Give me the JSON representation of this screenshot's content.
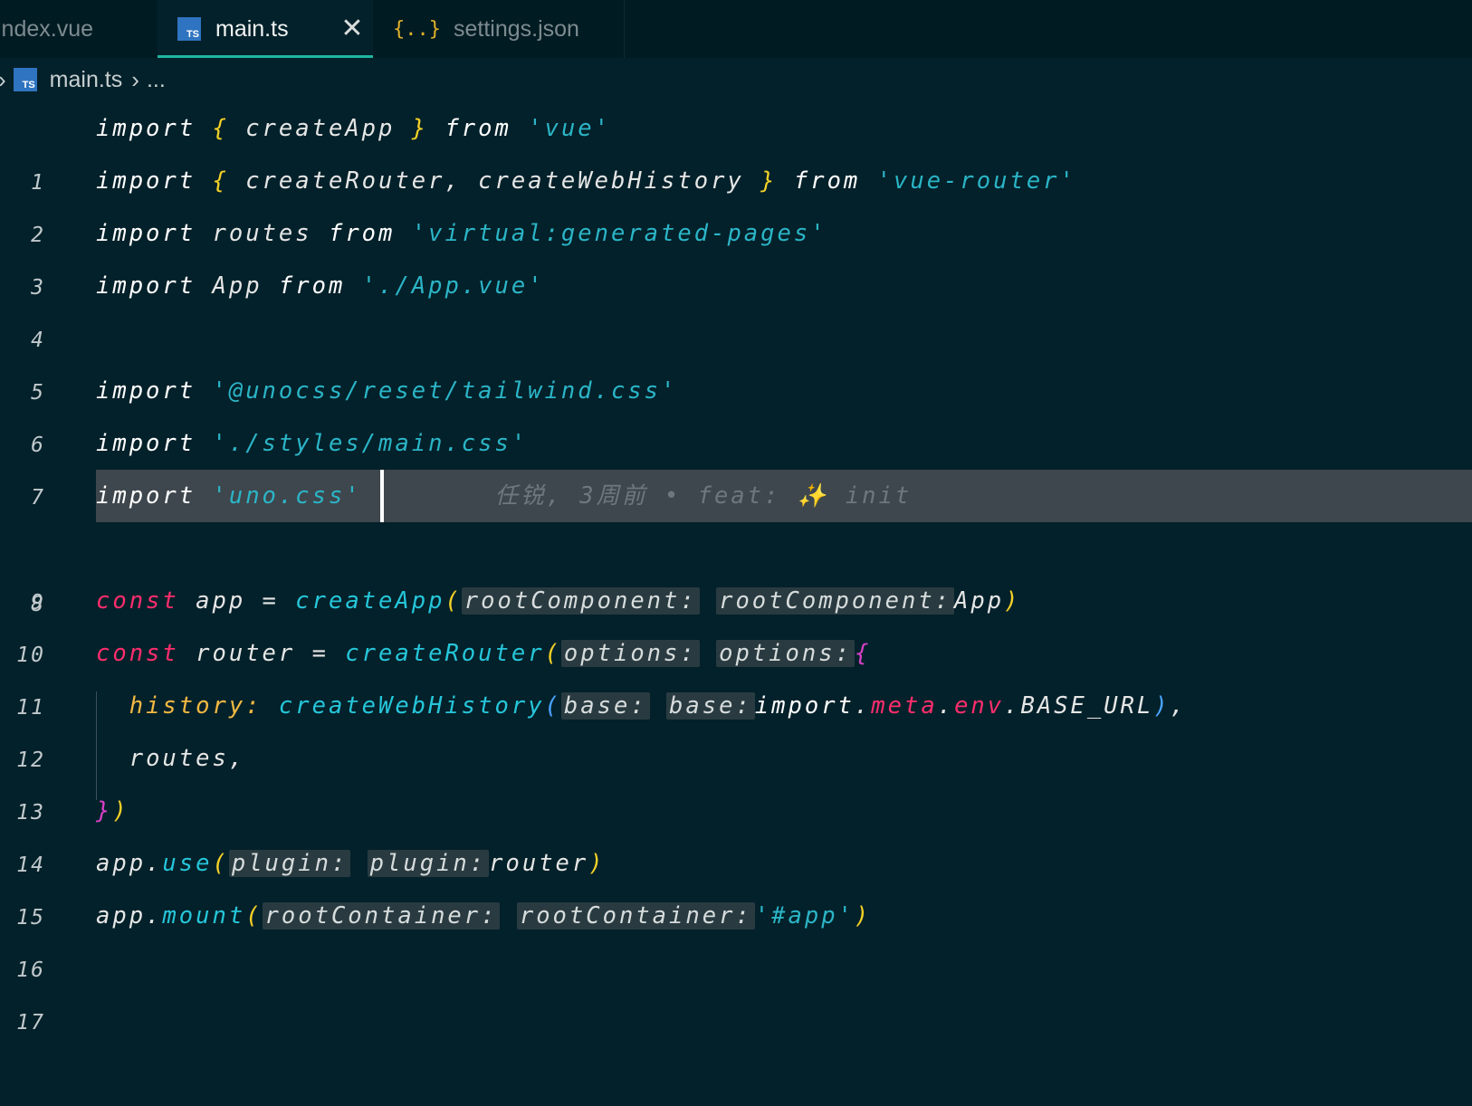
{
  "tabs": [
    {
      "label": "index.vue"
    },
    {
      "label": "main.ts",
      "icon": "ts-icon"
    },
    {
      "label": "settings.json",
      "icon": "json-icon"
    }
  ],
  "tab_close": "✕",
  "breadcrumb": {
    "file": "main.ts",
    "rest": "..."
  },
  "line_numbers": [
    "1",
    "2",
    "3",
    "4",
    "5",
    "6",
    "7",
    "8",
    "9",
    "10",
    "11",
    "12",
    "13",
    "14",
    "15",
    "16",
    "17"
  ],
  "code": {
    "l1": {
      "import": "import",
      "lb": "{",
      "name": "createApp",
      "rb": "}",
      "from": "from",
      "str": "'vue'"
    },
    "l2": {
      "import": "import",
      "lb": "{",
      "name": "createRouter,",
      "name2": "createWebHistory",
      "rb": "}",
      "from": "from",
      "str": "'vue-router'"
    },
    "l3": {
      "import": "import",
      "name": "routes",
      "from": "from",
      "str": "'virtual:generated-pages'"
    },
    "l4": {
      "import": "import",
      "name": "App",
      "from": "from",
      "str": "'./App.vue'"
    },
    "l6": {
      "import": "import",
      "str": "'@unocss/reset/tailwind.css'"
    },
    "l7": {
      "import": "import",
      "str": "'./styles/main.css'"
    },
    "l8": {
      "import": "import",
      "str": "'uno.css'",
      "blame": "任锐, 3周前 • feat: ✨ init"
    },
    "l10": {
      "const": "const",
      "name": "app",
      "eq": "=",
      "fn": "createApp",
      "lp": "(",
      "hint1": "rootComponent:",
      "hint2": "rootComponent:",
      "arg": "App",
      "rp": ")"
    },
    "l11": {
      "const": "const",
      "name": "router",
      "eq": "=",
      "fn": "createRouter",
      "lp": "(",
      "hint1": "options:",
      "hint2": "options:",
      "lb": "{"
    },
    "l12": {
      "prop": "history:",
      "fn": "createWebHistory",
      "lp": "(",
      "hint1": "base:",
      "hint2": "base:",
      "imp": "import",
      "d1": ".",
      "meta": "meta",
      "d2": ".",
      "env": "env",
      "d3": ".",
      "base": "BASE_URL",
      "rp": ")",
      "comma": ","
    },
    "l13": {
      "name": "routes,"
    },
    "l14": {
      "rb": "}",
      "rp": ")"
    },
    "l15": {
      "obj": "app",
      "dot": ".",
      "fn": "use",
      "lp": "(",
      "hint1": "plugin:",
      "hint2": "plugin:",
      "arg": "router",
      "rp": ")"
    },
    "l16": {
      "obj": "app",
      "dot": ".",
      "fn": "mount",
      "lp": "(",
      "hint1": "rootContainer:",
      "hint2": "rootContainer:",
      "str": "'#app'",
      "rp": ")"
    }
  },
  "colors": {
    "background": "#03212a",
    "string": "#2bb5c7",
    "keyword_const": "#ff2d6d",
    "brace": "#f2d027",
    "tab_active_underline": "#1fb5a0"
  }
}
